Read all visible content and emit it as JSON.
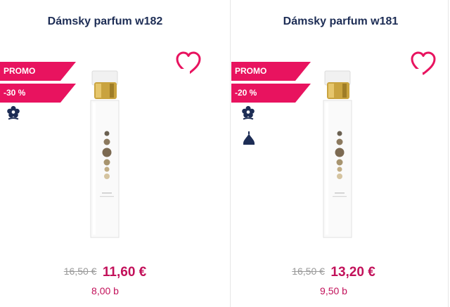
{
  "products": [
    {
      "title": "Dámsky parfum w182",
      "badge_promo": "PROMO",
      "badge_discount": "-30 %",
      "price_old": "16,50 €",
      "price_new": "11,60 €",
      "points": "8,00 b",
      "icons": [
        "heart-outline-icon",
        "flower-icon"
      ]
    },
    {
      "title": "Dámsky parfum w181",
      "badge_promo": "PROMO",
      "badge_discount": "-20 %",
      "price_old": "16,50 €",
      "price_new": "13,20 €",
      "points": "9,50 b",
      "icons": [
        "heart-outline-icon",
        "flower-icon",
        "perfume-drop-icon"
      ]
    }
  ],
  "colors": {
    "accent": "#e8135f",
    "title": "#1d2d55",
    "price": "#c2115a",
    "old_price": "#9a9a9a",
    "icon_navy": "#1d2d55"
  }
}
